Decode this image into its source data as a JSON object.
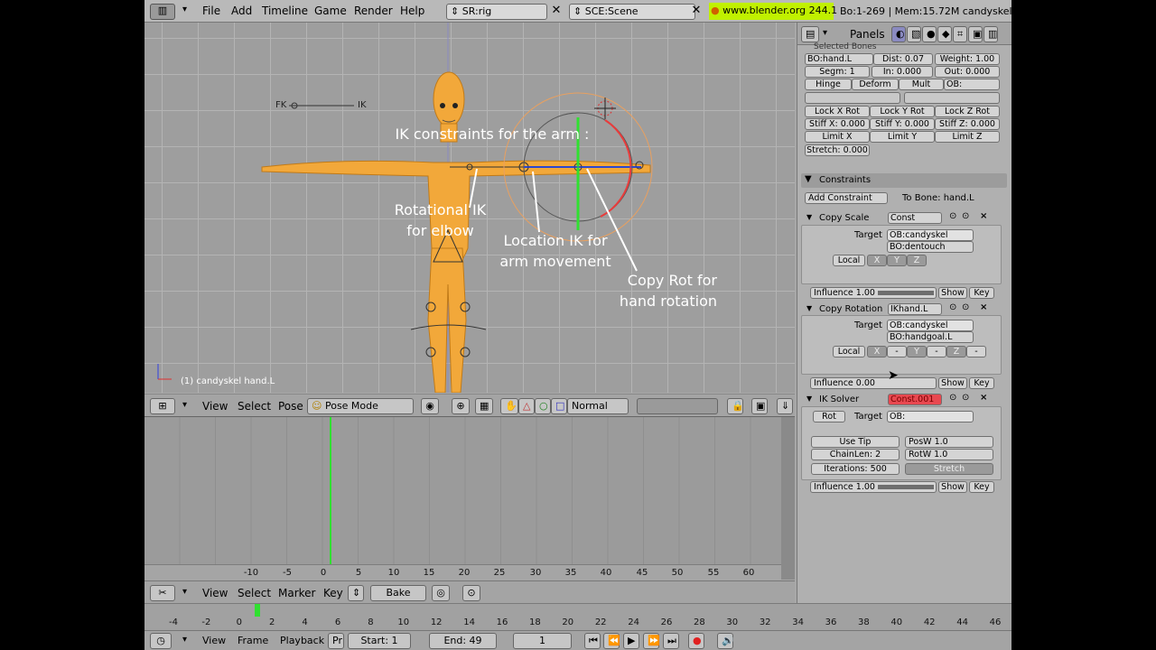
{
  "topbar": {
    "menus": [
      "File",
      "Add",
      "Timeline",
      "Game",
      "Render",
      "Help"
    ],
    "screen_field": "SR:rig",
    "scene_field": "SCE:Scene",
    "url": "www.blender.org 244.1",
    "stats": "Bo:1-269  | Mem:15.72M candyskel"
  },
  "viewport": {
    "fk_label": "FK",
    "ik_label": "IK",
    "annotation_title": "IK constraints for the arm :",
    "annotation_rot_ik": "Rotational IK for elbow",
    "annotation_loc_ik": "Location IK for arm movement",
    "annotation_copy_rot": "Copy Rot for hand rotation",
    "object_info": "(1) candyskel hand.L"
  },
  "viewport_header": {
    "menus": [
      "View",
      "Select",
      "Pose"
    ],
    "mode": "Pose Mode",
    "pivot": "Normal"
  },
  "timeline": {
    "ticks": [
      "-10",
      "-5",
      "0",
      "5",
      "10",
      "15",
      "20",
      "25",
      "30",
      "35",
      "40",
      "45",
      "50",
      "55",
      "60"
    ],
    "current_frame_marker": 1
  },
  "editor_header": {
    "menus": [
      "View",
      "Select",
      "Marker",
      "Key"
    ],
    "bake": "Bake"
  },
  "panels_header": {
    "label": "Panels"
  },
  "bones": {
    "section_title": "Selected Bones",
    "bone_name": "BO:hand.L",
    "dist": "Dist: 0.07",
    "weight": "Weight: 1.00",
    "segm": "Segm: 1",
    "in": "In: 0.000",
    "out": "Out: 0.000",
    "hinge": "Hinge",
    "deform": "Deform",
    "mult": "Mult",
    "ob": "OB:",
    "lock_x": "Lock X Rot",
    "lock_y": "Lock Y Rot",
    "lock_z": "Lock Z Rot",
    "stiff_x": "Stiff X: 0.000",
    "stiff_y": "Stiff Y: 0.000",
    "stiff_z": "Stiff Z: 0.000",
    "limit_x": "Limit X",
    "limit_y": "Limit Y",
    "limit_z": "Limit Z",
    "stretch": "Stretch: 0.000"
  },
  "constraints": {
    "title": "Constraints",
    "add": "Add Constraint",
    "to_bone": "To Bone: hand.L",
    "copy_scale": {
      "name": "Copy Scale",
      "const": "Const",
      "target_label": "Target",
      "ob": "OB:candyskel",
      "bo": "BO:dentouch",
      "local": "Local",
      "x": "X",
      "y": "Y",
      "z": "Z",
      "influence": "Influence 1.00",
      "influence_value": 1.0,
      "show": "Show",
      "key": "Key"
    },
    "copy_rotation": {
      "name": "Copy Rotation",
      "const": "IKhand.L",
      "target_label": "Target",
      "ob": "OB:candyskel",
      "bo": "BO:handgoal.L",
      "local": "Local",
      "x": "X",
      "dash": "-",
      "y": "Y",
      "z": "Z",
      "influence": "Influence 0.00",
      "influence_value": 0.0,
      "show": "Show",
      "key": "Key"
    },
    "ik_solver": {
      "name": "IK Solver",
      "const": "Const.001",
      "rot": "Rot",
      "target_label": "Target",
      "ob": "OB:",
      "use_tip": "Use Tip",
      "posw": "PosW 1.0",
      "chainlen": "ChainLen: 2",
      "rotw": "RotW 1.0",
      "iterations": "Iterations: 500",
      "stretch": "Stretch",
      "influence": "Influence 1.00",
      "influence_value": 1.0,
      "show": "Show",
      "key": "Key"
    }
  },
  "bottom": {
    "ticks": [
      "-4",
      "-2",
      "0",
      "2",
      "4",
      "6",
      "8",
      "10",
      "12",
      "14",
      "16",
      "18",
      "20",
      "22",
      "24",
      "26",
      "28",
      "30",
      "32",
      "34",
      "36",
      "38",
      "40",
      "42",
      "44",
      "46"
    ],
    "menus": [
      "View",
      "Frame",
      "Playback"
    ],
    "pr": "Pr",
    "start": "Start: 1",
    "end": "End: 49",
    "current": "1"
  },
  "colors": {
    "bone_orange": "#f5a21e",
    "ik_red": "#e83c3c",
    "url_green": "#c0f000"
  }
}
